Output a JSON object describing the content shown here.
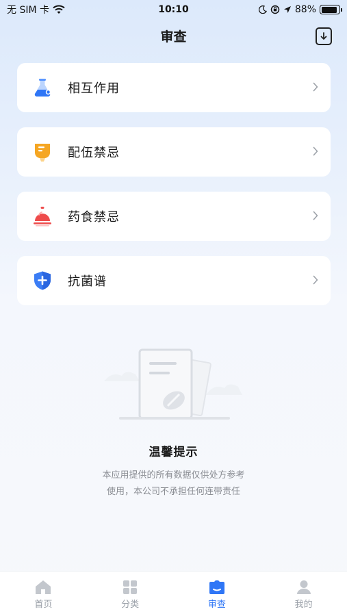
{
  "status_bar": {
    "carrier": "无 SIM 卡",
    "time": "10:10",
    "battery": "88%",
    "battery_level": 0.88
  },
  "nav": {
    "title": "审查",
    "action_icon": "download-icon"
  },
  "menu": {
    "items": [
      {
        "label": "相互作用",
        "icon": "flask-icon",
        "color": "#3b7df5"
      },
      {
        "label": "配伍禁忌",
        "icon": "infusion-bag-icon",
        "color": "#f5a623"
      },
      {
        "label": "药食禁忌",
        "icon": "food-cover-icon",
        "color": "#ee4b4b"
      },
      {
        "label": "抗菌谱",
        "icon": "shield-plus-icon",
        "color": "#3b7df5"
      }
    ]
  },
  "notice": {
    "title": "温馨提示",
    "line1": "本应用提供的所有数据仅供处方参考",
    "line2": "使用，本公司不承担任何连带责任"
  },
  "tabbar": {
    "tabs": [
      {
        "label": "首页",
        "icon": "home-icon",
        "active": false
      },
      {
        "label": "分类",
        "icon": "grid-icon",
        "active": false
      },
      {
        "label": "审查",
        "icon": "review-icon",
        "active": true
      },
      {
        "label": "我的",
        "icon": "user-icon",
        "active": false
      }
    ],
    "active_color": "#2f76f6",
    "inactive_color": "#c3c7cd"
  }
}
